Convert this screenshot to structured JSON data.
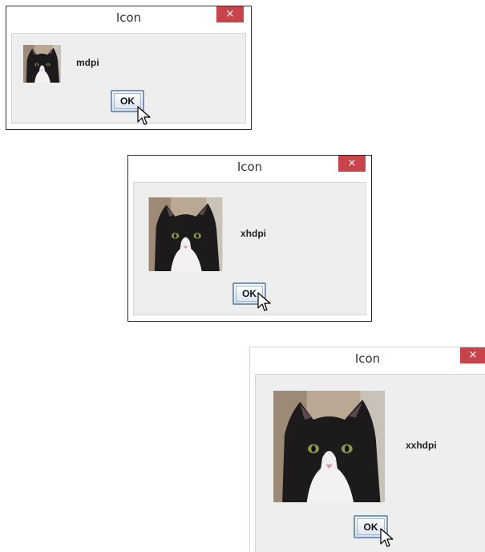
{
  "dialogs": [
    {
      "title": "Icon",
      "close_label": "×",
      "density_label": "mdpi",
      "ok_label": "OK",
      "icon": "cat-icon"
    },
    {
      "title": "Icon",
      "close_label": "×",
      "density_label": "xhdpi",
      "ok_label": "OK",
      "icon": "cat-icon"
    },
    {
      "title": "Icon",
      "close_label": "×",
      "density_label": "xxhdpi",
      "ok_label": "OK",
      "icon": "cat-icon"
    }
  ],
  "colors": {
    "close_button": "#c7444a",
    "content_background": "#eeeeee",
    "ok_border": "#7a95b4"
  }
}
